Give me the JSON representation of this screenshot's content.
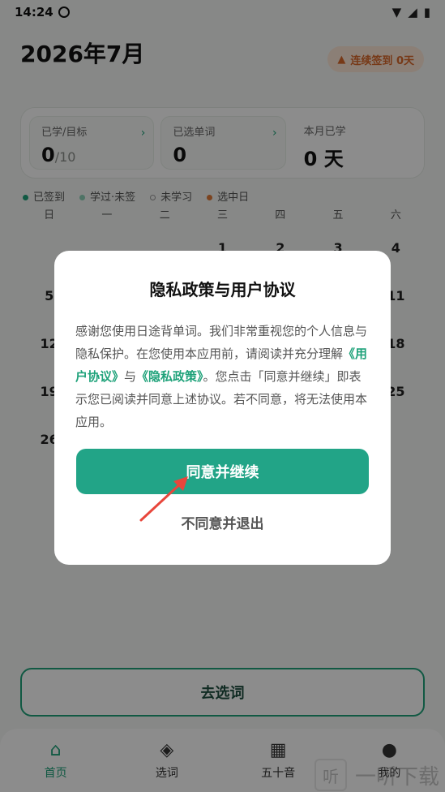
{
  "status": {
    "time": "14:24",
    "icons": [
      "wifi-icon",
      "signal-icon",
      "battery-icon"
    ]
  },
  "header": {
    "title": "2026年7月",
    "checkin": "连续签到 0天"
  },
  "stats": [
    {
      "label": "已学/目标",
      "value": "0",
      "sub": "/10"
    },
    {
      "label": "已选单词",
      "value": "0",
      "sub": ""
    },
    {
      "label": "本月已学",
      "value": "0 天",
      "sub": ""
    }
  ],
  "legend": [
    "已签到",
    "学过·未签",
    "未学习",
    "选中日"
  ],
  "weekdays": [
    "日",
    "一",
    "二",
    "三",
    "四",
    "五",
    "六"
  ],
  "calendar": [
    "",
    "",
    "",
    "1",
    "2",
    "3",
    "4",
    "5",
    "",
    "",
    "",
    "",
    "",
    "11",
    "12",
    "",
    "",
    "",
    "",
    "",
    "18",
    "19",
    "",
    "",
    "",
    "",
    "",
    "25",
    "26",
    "",
    "",
    "",
    "",
    "",
    ""
  ],
  "cta": {
    "label": "去选词"
  },
  "tabs": [
    {
      "label": "首页",
      "icon": "home-icon",
      "glyph": "⌂"
    },
    {
      "label": "选词",
      "icon": "layers-icon",
      "glyph": "◈"
    },
    {
      "label": "五十音",
      "icon": "grid-icon",
      "glyph": "▦"
    },
    {
      "label": "我的",
      "icon": "user-icon",
      "glyph": "●"
    }
  ],
  "modal": {
    "title": "隐私政策与用户协议",
    "body_1": "感谢您使用日途背单词。我们非常重视您的个人信息与隐私保护。在您使用本应用前，请阅读并充分理解",
    "link_1": "《用户协议》",
    "body_2": "与",
    "link_2": "《隐私政策》",
    "body_3": "。您点击「同意并继续」即表示您已阅读并同意上述协议。若不同意，将无法使用本应用。",
    "agree": "同意并继续",
    "decline": "不同意并退出"
  },
  "watermark": {
    "text": "一听下载",
    "glyph": "听"
  },
  "colors": {
    "accent": "#22a487",
    "checkin": "#d9682b"
  }
}
